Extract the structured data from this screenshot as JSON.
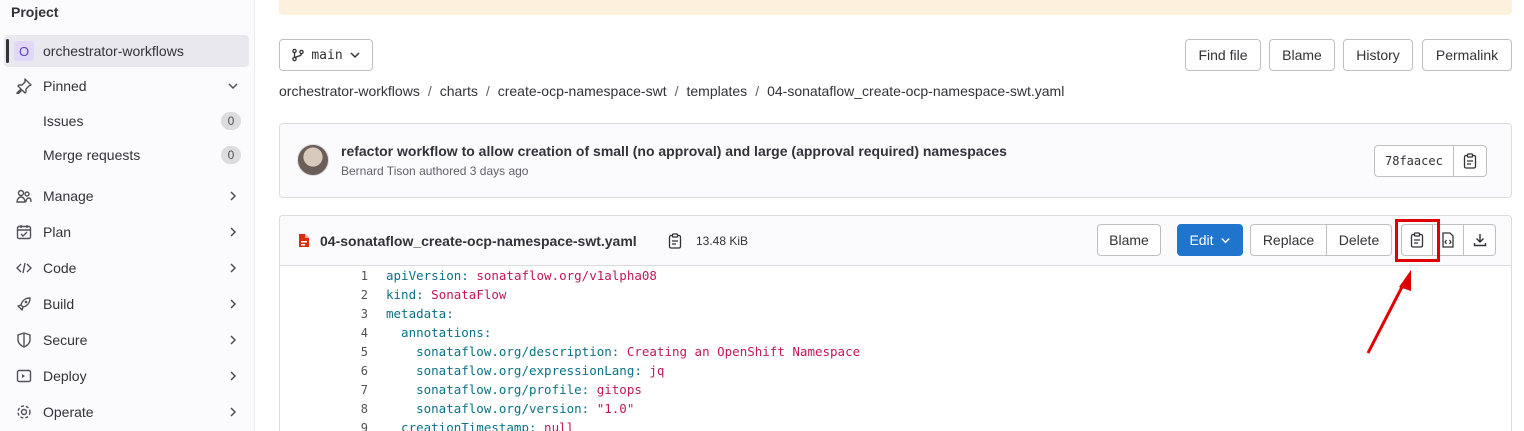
{
  "sidebar": {
    "title": "Project",
    "project_initial": "O",
    "project_name": "orchestrator-workflows",
    "items": [
      {
        "label": "Pinned"
      },
      {
        "label": "Manage"
      },
      {
        "label": "Plan"
      },
      {
        "label": "Code"
      },
      {
        "label": "Build"
      },
      {
        "label": "Secure"
      },
      {
        "label": "Deploy"
      },
      {
        "label": "Operate"
      }
    ],
    "pinned_sub": [
      {
        "label": "Issues",
        "count": "0"
      },
      {
        "label": "Merge requests",
        "count": "0"
      }
    ]
  },
  "toolbar": {
    "branch": "main",
    "find_file": "Find file",
    "blame": "Blame",
    "history": "History",
    "permalink": "Permalink"
  },
  "breadcrumb": [
    "orchestrator-workflows",
    "charts",
    "create-ocp-namespace-swt",
    "templates",
    "04-sonataflow_create-ocp-namespace-swt.yaml"
  ],
  "commit": {
    "title": "refactor workflow to allow creation of small (no approval) and large (approval required) namespaces",
    "author": "Bernard Tison",
    "meta_suffix": "authored 3 days ago",
    "sha": "78faacec"
  },
  "file": {
    "name": "04-sonataflow_create-ocp-namespace-swt.yaml",
    "size": "13.48 KiB",
    "blame": "Blame",
    "edit": "Edit",
    "replace": "Replace",
    "delete": "Delete"
  },
  "code_lines": [
    {
      "n": "1",
      "key": "apiVersion:",
      "val": " sonataflow.org/v1alpha08"
    },
    {
      "n": "2",
      "key": "kind:",
      "val": " SonataFlow"
    },
    {
      "n": "3",
      "key": "metadata:",
      "val": ""
    },
    {
      "n": "4",
      "key": "  annotations:",
      "val": ""
    },
    {
      "n": "5",
      "key": "    sonataflow.org/description:",
      "val": " Creating an OpenShift Namespace"
    },
    {
      "n": "6",
      "key": "    sonataflow.org/expressionLang:",
      "val": " jq"
    },
    {
      "n": "7",
      "key": "    sonataflow.org/profile:",
      "val": " gitops"
    },
    {
      "n": "8",
      "key": "    sonataflow.org/version:",
      "val": " \"1.0\""
    },
    {
      "n": "9",
      "key": "  creationTimestamp:",
      "val": " null"
    }
  ],
  "colors": {
    "accent": "#1f75cb",
    "annotation": "#e00000"
  }
}
